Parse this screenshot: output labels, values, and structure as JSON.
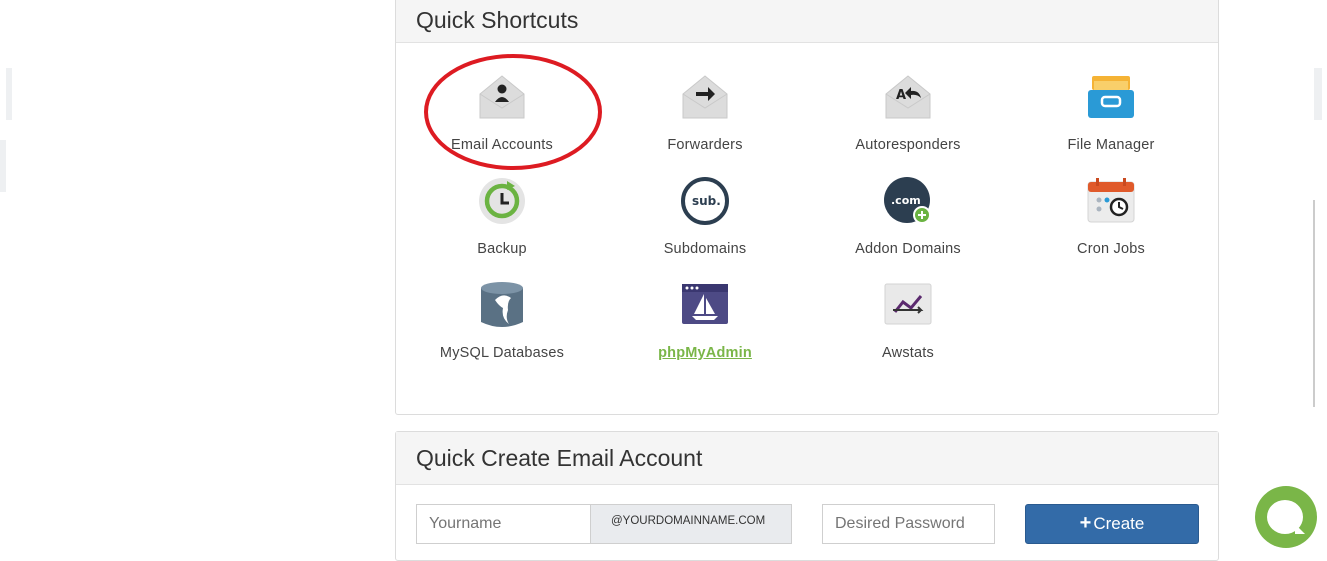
{
  "quick_shortcuts": {
    "title": "Quick Shortcuts",
    "items": [
      {
        "label": "Email Accounts",
        "icon": "envelope-user-icon"
      },
      {
        "label": "Forwarders",
        "icon": "envelope-arrow-icon"
      },
      {
        "label": "Autoresponders",
        "icon": "envelope-reply-icon"
      },
      {
        "label": "File Manager",
        "icon": "file-drawer-icon"
      },
      {
        "label": "Backup",
        "icon": "backup-clock-icon"
      },
      {
        "label": "Subdomains",
        "icon": "sub-badge-icon"
      },
      {
        "label": "Addon Domains",
        "icon": "dotcom-plus-icon"
      },
      {
        "label": "Cron Jobs",
        "icon": "calendar-clock-icon"
      },
      {
        "label": "MySQL Databases",
        "icon": "database-dolphin-icon"
      },
      {
        "label": "phpMyAdmin",
        "icon": "sailboat-window-icon"
      },
      {
        "label": "Awstats",
        "icon": "trend-chart-icon"
      }
    ]
  },
  "quick_create_email": {
    "title": "Quick Create Email Account",
    "username_placeholder": "Yourname",
    "domain_suffix": "@YOURDOMAINNAME.COM",
    "password_placeholder": "Desired Password",
    "create_label": "Create"
  },
  "colors": {
    "highlight_ring": "#dd1b22",
    "link_green": "#7ab648",
    "button_blue": "#336ba8"
  }
}
